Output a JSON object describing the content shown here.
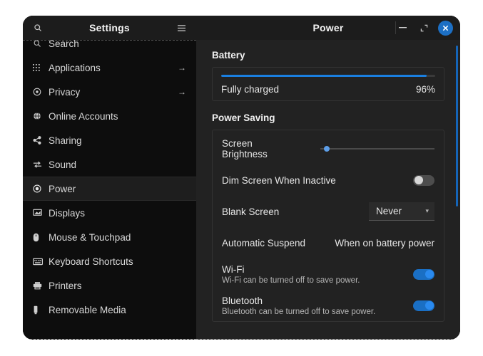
{
  "window": {
    "sidebar_title": "Settings",
    "content_title": "Power",
    "search_icon": "search-icon",
    "menu_icon": "hamburger-icon",
    "minimize_label": "−",
    "maximize_label": "⤢",
    "close_label": "✕",
    "close_color": "#1c6fc4"
  },
  "sidebar": {
    "items": [
      {
        "label": "Search",
        "icon": "search-icon",
        "arrow": "",
        "active": false
      },
      {
        "label": "Applications",
        "icon": "grid-icon",
        "arrow": "→",
        "active": false
      },
      {
        "label": "Privacy",
        "icon": "target-icon",
        "arrow": "→",
        "active": false
      },
      {
        "label": "Online Accounts",
        "icon": "globe-icon",
        "arrow": "",
        "active": false
      },
      {
        "label": "Sharing",
        "icon": "share-icon",
        "arrow": "",
        "active": false
      },
      {
        "label": "Sound",
        "icon": "sound-icon",
        "arrow": "",
        "active": false
      },
      {
        "label": "Power",
        "icon": "power-icon",
        "arrow": "",
        "active": true
      },
      {
        "label": "Displays",
        "icon": "display-icon",
        "arrow": "",
        "active": false
      },
      {
        "label": "Mouse & Touchpad",
        "icon": "mouse-icon",
        "arrow": "",
        "active": false
      },
      {
        "label": "Keyboard Shortcuts",
        "icon": "keyboard-icon",
        "arrow": "",
        "active": false
      },
      {
        "label": "Printers",
        "icon": "printer-icon",
        "arrow": "",
        "active": false
      },
      {
        "label": "Removable Media",
        "icon": "usb-icon",
        "arrow": "",
        "active": false
      }
    ]
  },
  "content": {
    "battery": {
      "section_title": "Battery",
      "status": "Fully charged",
      "percent_label": "96%",
      "percent_value": 96,
      "bar_color": "#1a7fe0"
    },
    "power_saving": {
      "section_title": "Power Saving",
      "brightness": {
        "label": "Screen Brightness",
        "value": 3,
        "thumb_color": "#5d9ee8"
      },
      "dim_screen": {
        "label": "Dim Screen When Inactive",
        "state": "off"
      },
      "blank_screen": {
        "label": "Blank Screen",
        "value": "Never",
        "caret": "▾"
      },
      "automatic_suspend": {
        "label": "Automatic Suspend",
        "value": "When on battery power"
      },
      "wifi": {
        "label": "Wi-Fi",
        "description": "Wi-Fi can be turned off to save power.",
        "state": "on"
      },
      "bluetooth": {
        "label": "Bluetooth",
        "description": "Bluetooth can be turned off to save power.",
        "state": "on"
      }
    }
  }
}
